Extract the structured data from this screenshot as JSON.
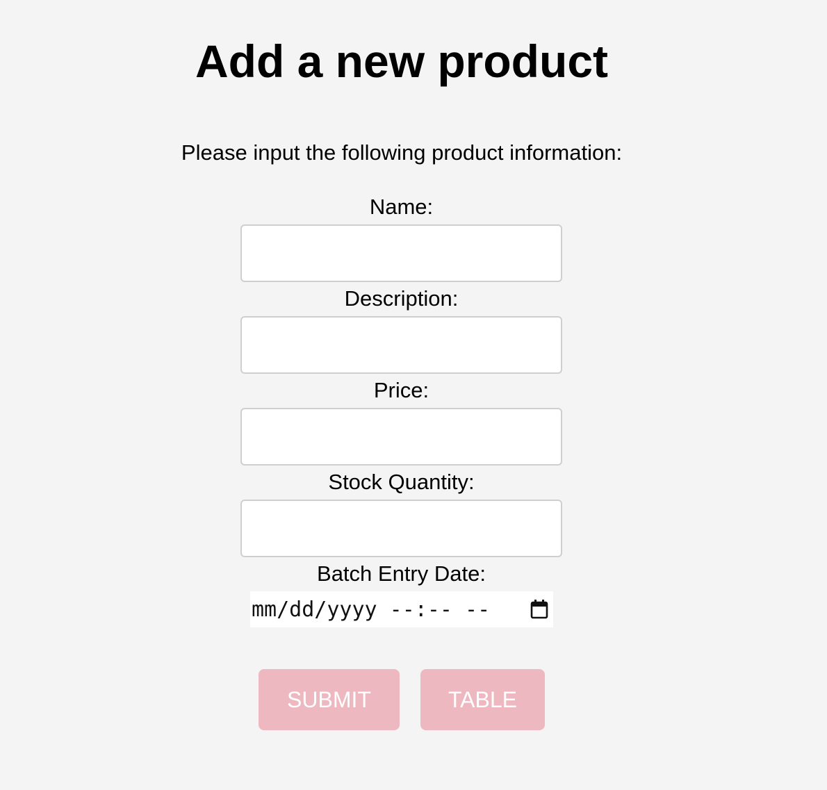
{
  "page": {
    "title": "Add a new product",
    "intro": "Please input the following product information:"
  },
  "form": {
    "name_label": "Name:",
    "name_value": "",
    "description_label": "Description:",
    "description_value": "",
    "price_label": "Price:",
    "price_value": "",
    "stock_label": "Stock Quantity:",
    "stock_value": "",
    "batch_date_label": "Batch Entry Date:",
    "batch_date_placeholder": "mm/dd/yyyy --:-- --"
  },
  "buttons": {
    "submit_label": "SUBMIT",
    "table_label": "TABLE"
  },
  "colors": {
    "background": "#f4f4f4",
    "button_bg": "#eeb8c0",
    "button_text": "#ffffff",
    "input_border": "#cfcfcf"
  },
  "icons": {
    "date_picker": "calendar-icon"
  }
}
